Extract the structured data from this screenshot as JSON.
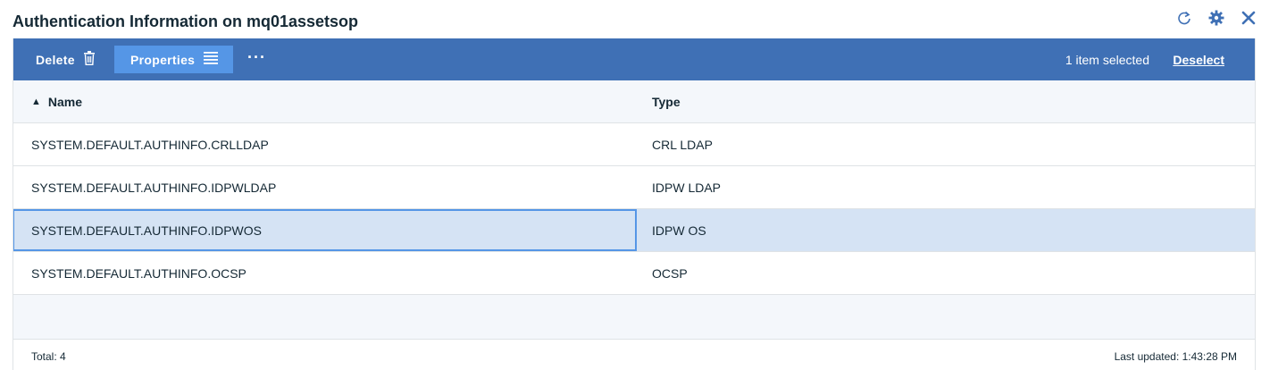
{
  "page": {
    "title": "Authentication Information on mq01assetsop"
  },
  "window_icons": [
    {
      "icon": "refresh-icon",
      "color": "#3f70b5"
    },
    {
      "icon": "gear-icon",
      "color": "#3f70b5"
    },
    {
      "icon": "close-icon",
      "color": "#3f70b5"
    }
  ],
  "toolbar": {
    "delete_label": "Delete",
    "delete_icon": "trash-icon",
    "properties_label": "Properties",
    "properties_icon": "list-icon",
    "more_label": "···",
    "selection_text": "1 item selected",
    "deselect_label": "Deselect",
    "background": "#3f70b5",
    "active_button_color": "#5596e6"
  },
  "table": {
    "columns": {
      "name": "Name",
      "type": "Type",
      "sort_indicator": "▲"
    },
    "rows": [
      {
        "name": "SYSTEM.DEFAULT.AUTHINFO.CRLLDAP",
        "type": "CRL LDAP"
      },
      {
        "name": "SYSTEM.DEFAULT.AUTHINFO.IDPWLDAP",
        "type": "IDPW LDAP"
      },
      {
        "name": "SYSTEM.DEFAULT.AUTHINFO.IDPWOS",
        "type": "IDPW OS"
      },
      {
        "name": "SYSTEM.DEFAULT.AUTHINFO.OCSP",
        "type": "OCSP"
      }
    ],
    "selected_row_color": "#d5e3f4"
  },
  "footer": {
    "total": "Total: 4",
    "last_updated": "Last updated: 1:43:28 PM"
  }
}
